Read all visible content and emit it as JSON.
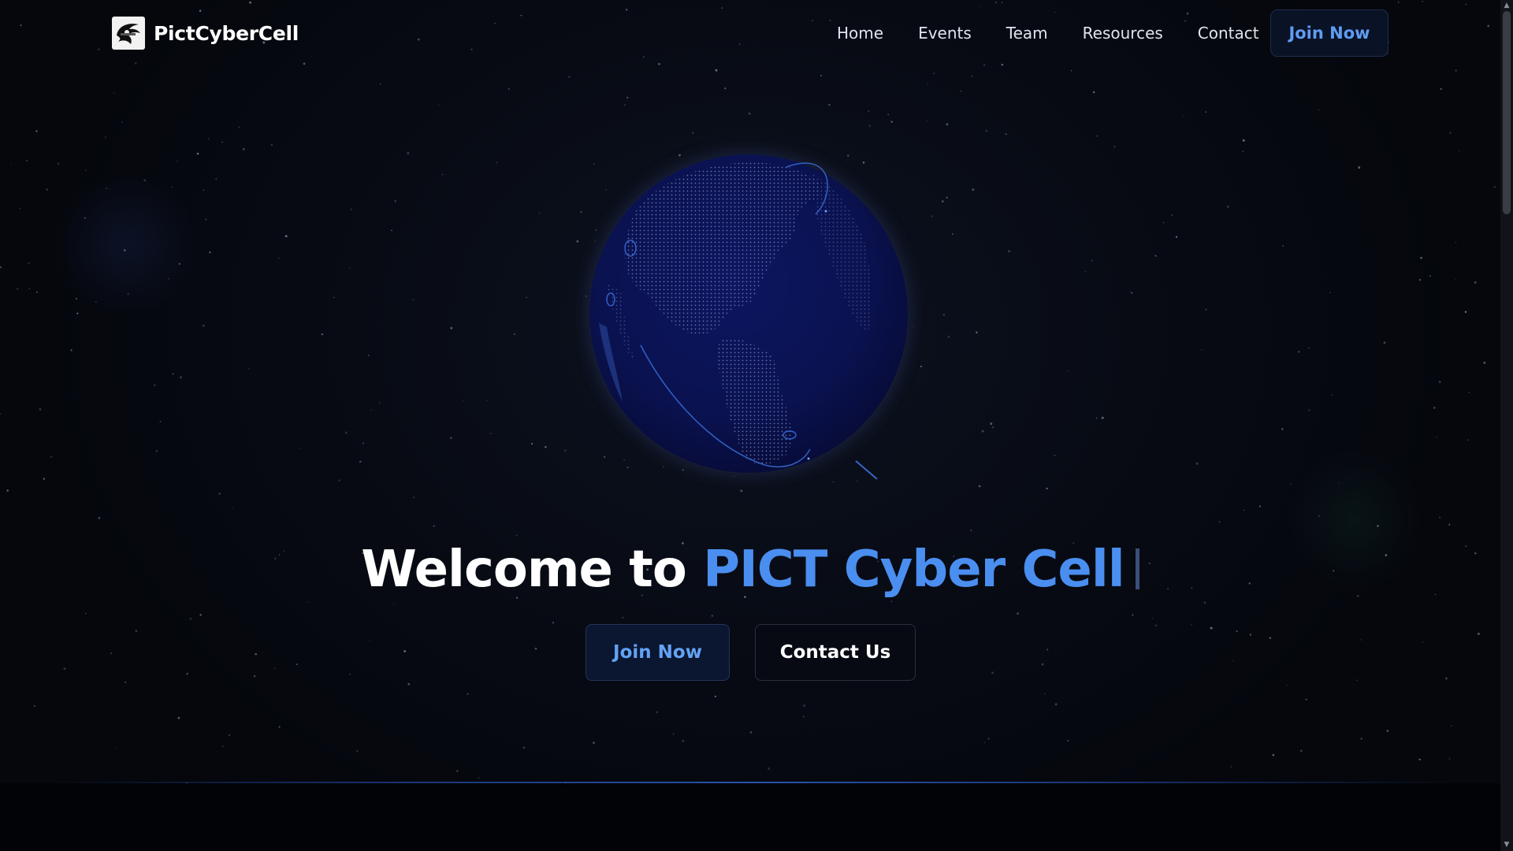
{
  "brand": {
    "name": "PictCyberCell",
    "logo_icon": "eagle-logo-icon"
  },
  "nav": {
    "links": [
      "Home",
      "Events",
      "Team",
      "Resources",
      "Contact"
    ],
    "join_label": "Join Now"
  },
  "hero": {
    "title_prefix": "Welcome to",
    "title_accent": "PICT Cyber Cell",
    "primary_button": "Join Now",
    "secondary_button": "Contact Us"
  },
  "colors": {
    "accent": "#4a8ef0",
    "background": "#06080f",
    "globe": "#0a1250"
  }
}
